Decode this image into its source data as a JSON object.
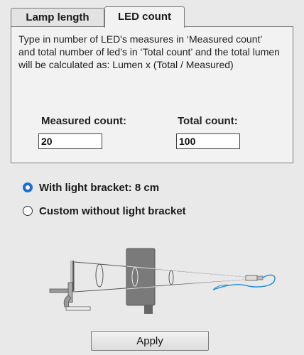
{
  "tabs": [
    {
      "label": "Lamp length",
      "active": false
    },
    {
      "label": "LED count",
      "active": true
    }
  ],
  "panel": {
    "description": "Type in number of LED's measures in ‘Measured count’ and total number of led's in ‘Total count’ and the total lumen will be calculated as: Lumen x (Total / Measured)",
    "measured_label": "Measured count:",
    "measured_value": "20",
    "total_label": "Total count:",
    "total_value": "100"
  },
  "options": [
    {
      "label": "With light bracket: 8 cm",
      "checked": true
    },
    {
      "label": "Custom without light bracket",
      "checked": false
    }
  ],
  "apply_label": "Apply",
  "colors": {
    "background": "#e9e9e9",
    "panel": "#f2f2f2",
    "radio_selected": "#1a6fd0",
    "cable": "#2b8fd6"
  },
  "icons": {
    "diagram": "lamp-measurement-diagram"
  }
}
